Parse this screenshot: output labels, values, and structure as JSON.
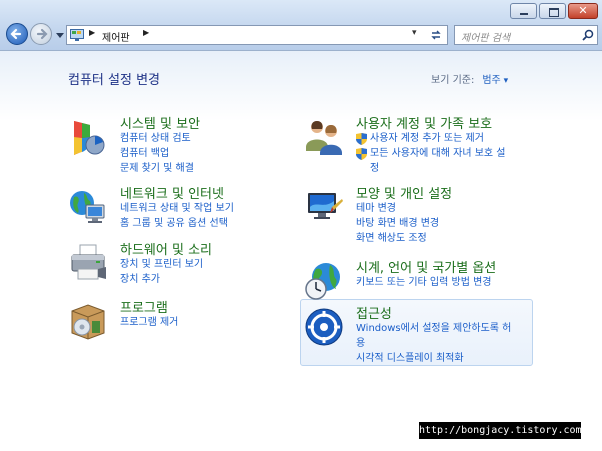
{
  "address": {
    "crumb": "제어판"
  },
  "search": {
    "placeholder": "제어판 검색"
  },
  "header": {
    "title": "컴퓨터 설정 변경",
    "view_by_label": "보기 기준:",
    "view_by_value": "범주"
  },
  "categories": [
    {
      "title": "시스템 및 보안",
      "links": [
        "컴퓨터 상태 검토",
        "컴퓨터 백업",
        "문제 찾기 및 해결"
      ]
    },
    {
      "title": "네트워크 및 인터넷",
      "links": [
        "네트워크 상태 및 작업 보기",
        "홈 그룹 및 공유 옵션 선택"
      ]
    },
    {
      "title": "하드웨어 및 소리",
      "links": [
        "장치 및 프린터 보기",
        "장치 추가"
      ]
    },
    {
      "title": "프로그램",
      "links": [
        "프로그램 제거"
      ]
    },
    {
      "title": "사용자 계정 및 가족 보호",
      "links": [
        "사용자 계정 추가 또는 제거",
        "모든 사용자에 대해 자녀 보호 설",
        "정"
      ]
    },
    {
      "title": "모양 및 개인 설정",
      "links": [
        "테마 변경",
        "바탕 화면 배경 변경",
        "화면 해상도 조정"
      ]
    },
    {
      "title": "시계, 언어 및 국가별 옵션",
      "links": [
        "키보드 또는 기타 입력 방법 변경"
      ]
    },
    {
      "title": "접근성",
      "links": [
        "Windows에서 설정을 제안하도록 허",
        "용",
        "시각적 디스플레이 최적화"
      ]
    }
  ],
  "watermark": "http://bongjacy.tistory.com"
}
